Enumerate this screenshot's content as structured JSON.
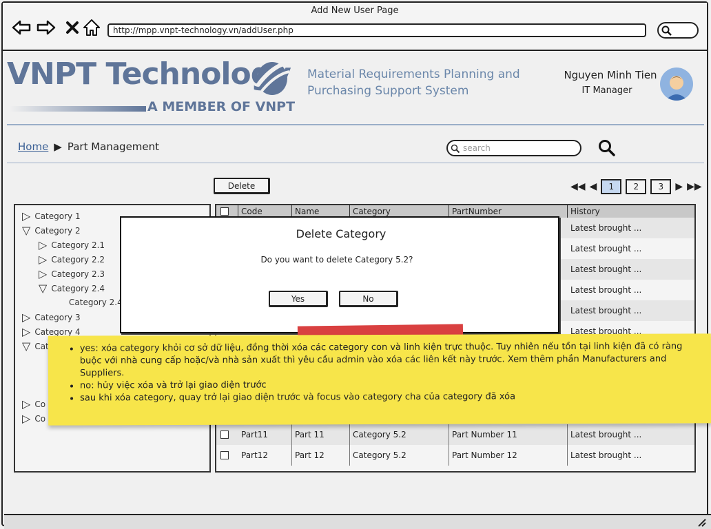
{
  "window": {
    "title": "Add New User Page",
    "url": "http://mpp.vnpt-technology.vn/addUser.php"
  },
  "nav_icons": [
    "back-arrow-icon",
    "forward-arrow-icon",
    "close-icon",
    "home-icon"
  ],
  "header": {
    "logo_text": "VNPT Technology",
    "logo_subtitle": "A MEMBER OF VNPT",
    "system_title": "Material Requirements Planning and Purchasing Support System",
    "user_name": "Nguyen Minh Tien",
    "user_role": "IT Manager"
  },
  "breadcrumb": {
    "home": "Home",
    "current": "Part Management"
  },
  "search": {
    "placeholder": "search"
  },
  "toolbar": {
    "delete_label": "Delete"
  },
  "pager": {
    "pages": [
      "1",
      "2",
      "3"
    ],
    "active": "1"
  },
  "tree": {
    "items": [
      {
        "label": "Category 1",
        "state": "collapsed"
      },
      {
        "label": "Category 2",
        "state": "expanded"
      },
      {
        "label": "Category 2.1",
        "state": "collapsed"
      },
      {
        "label": "Category 2.2",
        "state": "collapsed"
      },
      {
        "label": "Category 2.3",
        "state": "collapsed"
      },
      {
        "label": "Category 2.4",
        "state": "expanded"
      },
      {
        "label": "Category 2.4",
        "state": "leaf"
      },
      {
        "label": "Category 3",
        "state": "collapsed"
      },
      {
        "label": "Category 4",
        "state": "collapsed"
      },
      {
        "label": "Cat",
        "state": "expanded"
      },
      {
        "label": "Co",
        "state": "collapsed"
      },
      {
        "label": "Co",
        "state": "collapsed"
      }
    ]
  },
  "table": {
    "columns": [
      "Code",
      "Name",
      "Category",
      "PartNumber",
      "History"
    ],
    "history_cells": [
      "Latest brought ...",
      "Latest brought ...",
      "Latest brought ...",
      "Latest brought ...",
      "Latest brought ...",
      "Latest brought ..."
    ],
    "rows": [
      {
        "code": "Part11",
        "name": "Part 11",
        "category": "Category 5.2",
        "part_number": "Part Number 11",
        "history": "Latest brought ..."
      },
      {
        "code": "Part12",
        "name": "Part 12",
        "category": "Category 5.2",
        "part_number": "Part Number 12",
        "history": "Latest brought ..."
      }
    ]
  },
  "dialog": {
    "title": "Delete Category",
    "message": "Do you want to delete Category 5.2?",
    "yes_label": "Yes",
    "no_label": "No"
  },
  "note": {
    "items": [
      "yes: xóa category khỏi cơ sở dữ liệu, đồng thời xóa các category con và linh kiện trực thuộc. Tuy nhiên nếu tồn tại linh kiện đã có ràng buộc với nhà cung cấp hoặc/và nhà sản xuất thì yêu cầu admin vào xóa các liên kết này trước. Xem thêm phần Manufacturers and Suppliers.",
      "no: hủy việc xóa và trở lại giao diện trước",
      "sau khi xóa category, quay trở lại giao diện trước và focus vào category cha của category đã xóa"
    ]
  },
  "colors": {
    "brand": "#5f7599",
    "note_bg": "#f7e54a",
    "tape": "#d94040",
    "active_page": "#c6d8f0"
  }
}
